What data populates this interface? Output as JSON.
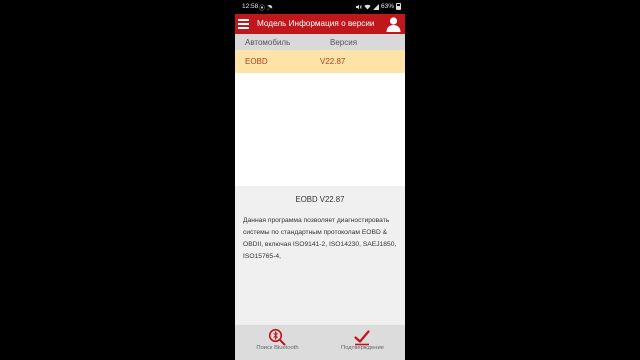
{
  "status_bar": {
    "time": "12:58",
    "left_icons": "⦿ ☂",
    "battery_percent": "63%",
    "battery_level": 0.63,
    "icons": [
      "alarm-icon",
      "umbrella-icon",
      "mute-icon",
      "wifi-icon",
      "signal-icon",
      "battery-icon"
    ]
  },
  "app_bar": {
    "title": "Модель Информация о версии",
    "background": "#c0171c"
  },
  "table": {
    "headers": {
      "car": "Автомобиль",
      "version": "Версия"
    },
    "rows": [
      {
        "name": "EOBD",
        "version": "V22.87",
        "selected": true
      }
    ]
  },
  "info": {
    "title": "EOBD V22.87",
    "description": "Данная программа позволяет диагностировать системы по стандартным протоколам EOBD & OBDII, включая ISO9141-2, ISO14230, SAEJ1850, ISO15765-4,"
  },
  "bottom_bar": {
    "search_label": "Поиск Bluetooth",
    "confirm_label": "Подтверждение",
    "accent": "#c0171c"
  }
}
